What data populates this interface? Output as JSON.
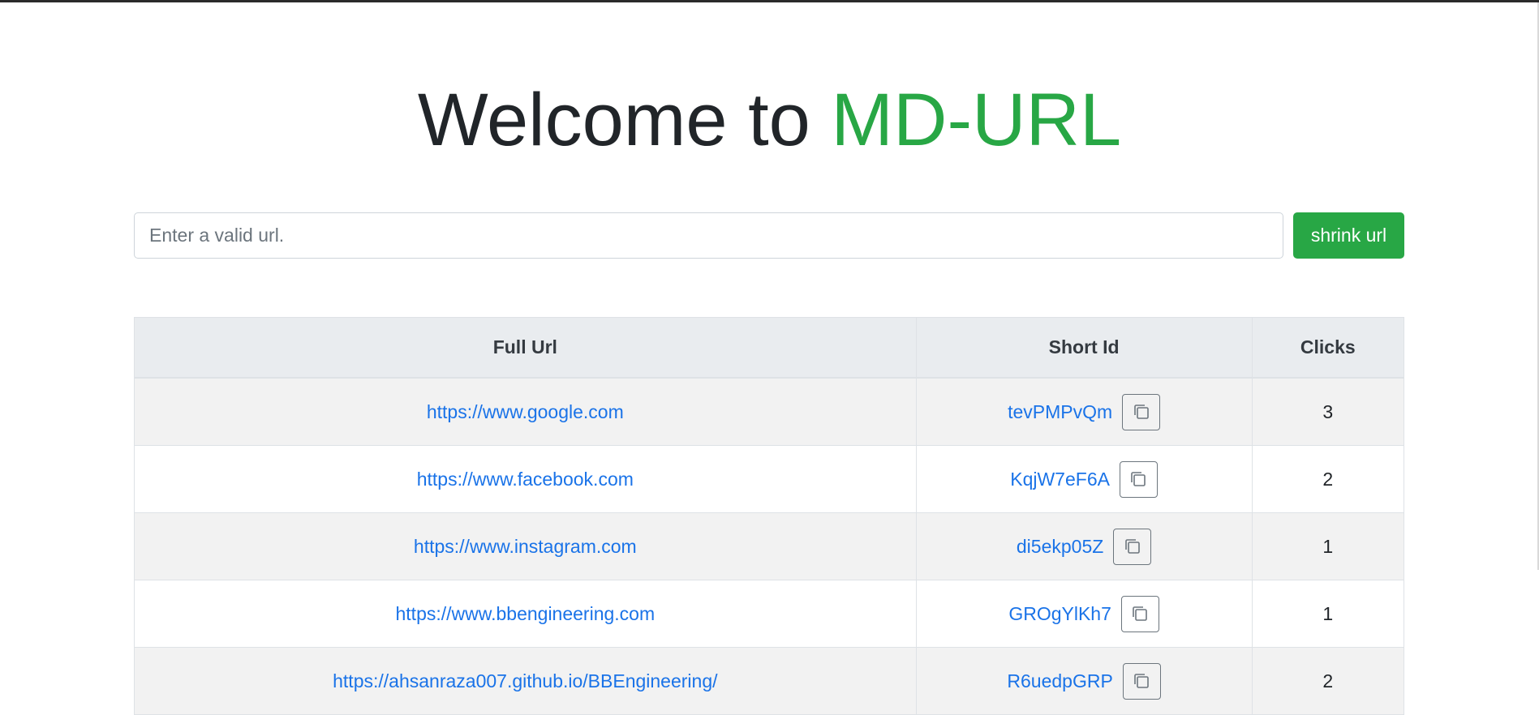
{
  "header": {
    "title_prefix": "Welcome to ",
    "title_brand": "MD-URL"
  },
  "form": {
    "placeholder": "Enter a valid url.",
    "value": "",
    "submit_label": "shrink url"
  },
  "table": {
    "headers": {
      "full_url": "Full Url",
      "short_id": "Short Id",
      "clicks": "Clicks"
    },
    "rows": [
      {
        "full_url": "https://www.google.com",
        "short_id": "tevPMPvQm",
        "clicks": "3"
      },
      {
        "full_url": "https://www.facebook.com",
        "short_id": "KqjW7eF6A",
        "clicks": "2"
      },
      {
        "full_url": "https://www.instagram.com",
        "short_id": "di5ekp05Z",
        "clicks": "1"
      },
      {
        "full_url": "https://www.bbengineering.com",
        "short_id": "GROgYlKh7",
        "clicks": "1"
      },
      {
        "full_url": "https://ahsanraza007.github.io/BBEngineering/",
        "short_id": "R6uedpGRP",
        "clicks": "2"
      }
    ]
  },
  "colors": {
    "brand": "#28a745",
    "link": "#1a73e8",
    "header_bg": "#e9ecef",
    "stripe_bg": "#f2f2f2"
  },
  "icons": {
    "copy": "copy-icon"
  }
}
